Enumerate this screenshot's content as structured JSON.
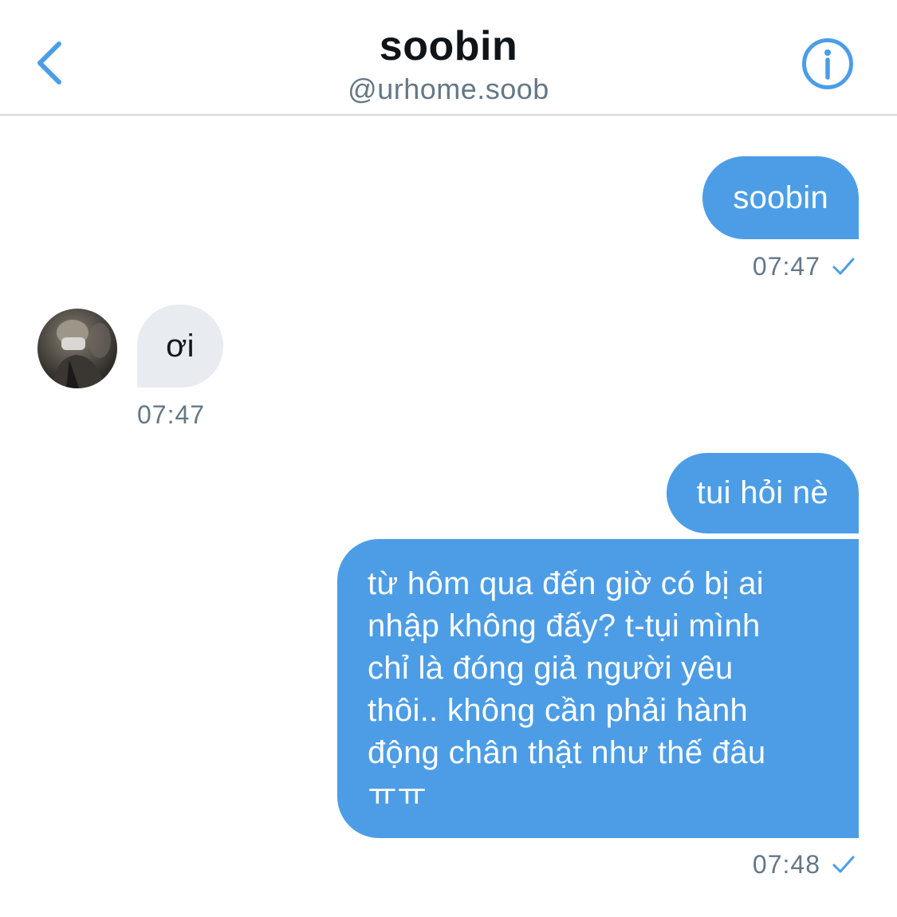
{
  "header": {
    "title": "soobin",
    "handle": "@urhome.soob",
    "back_icon": "chevron-left-icon",
    "info_icon": "info-icon",
    "accent_color": "#4c9de6"
  },
  "messages": [
    {
      "direction": "sent",
      "text": "soobin",
      "time": "07:47",
      "read": true
    },
    {
      "direction": "received",
      "text": "ơi",
      "time": "07:47"
    },
    {
      "direction": "sent",
      "text": "tui hỏi nè"
    },
    {
      "direction": "sent",
      "lines": [
        "từ hôm qua đến giờ có bị ai",
        "nhập không đấy? t-tụi mình",
        "chỉ là đóng giả người yêu",
        "thôi.. không cần phải hành",
        "động chân thật như thế đâu",
        "ㅠㅠ"
      ],
      "time": "07:48",
      "read": true
    }
  ],
  "colors": {
    "sent_bubble": "#4c9de6",
    "received_bubble": "#e8ebf0",
    "timestamp": "#657786"
  }
}
